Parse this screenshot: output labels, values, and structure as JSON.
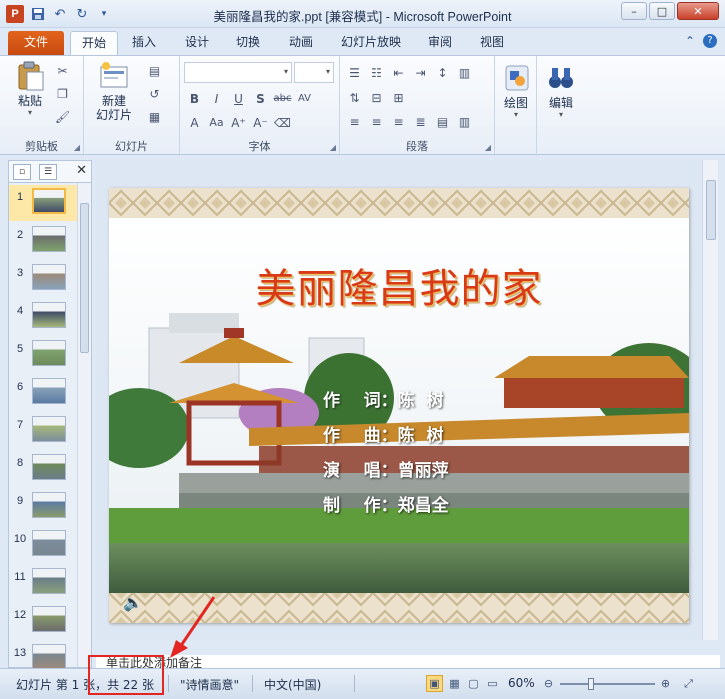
{
  "window": {
    "title": "美丽隆昌我的家.ppt [兼容模式] - Microsoft PowerPoint",
    "app_letter": "P",
    "ctrl_min": "–",
    "ctrl_max": "□",
    "ctrl_close": "✕"
  },
  "tabs": {
    "file": "文件",
    "items": [
      "开始",
      "插入",
      "设计",
      "切换",
      "动画",
      "幻灯片放映",
      "审阅",
      "视图"
    ],
    "active_index": 0
  },
  "ribbon": {
    "clipboard": {
      "label": "剪贴板",
      "paste": "粘贴"
    },
    "slides": {
      "label": "幻灯片",
      "new_slide_line1": "新建",
      "new_slide_line2": "幻灯片"
    },
    "font": {
      "label": "字体"
    },
    "paragraph": {
      "label": "段落"
    },
    "drawing": {
      "label": "绘图"
    },
    "editing": {
      "label": "编辑"
    }
  },
  "thumbnails": {
    "numbers": [
      "1",
      "2",
      "3",
      "4",
      "5",
      "6",
      "7",
      "8",
      "9",
      "10",
      "11",
      "12",
      "13"
    ],
    "active_index": 0
  },
  "slide": {
    "title": "美丽隆昌我的家",
    "credits": [
      "作    词：陈  树",
      "作    曲：陈  树",
      "演    唱：曾丽萍",
      "制    作：郑昌全"
    ]
  },
  "notes": {
    "placeholder": "单击此处添加备注"
  },
  "status": {
    "slide_info": "幻灯片 第 1 张，共 22 张",
    "theme": "\"诗情画意\"",
    "language": "中文(中国)",
    "zoom": "60%",
    "zoom_fraction": 0.6
  },
  "colors": {
    "file_tab": "#d2531a",
    "title_red": "#d83a17",
    "annotation": "#e42622"
  }
}
